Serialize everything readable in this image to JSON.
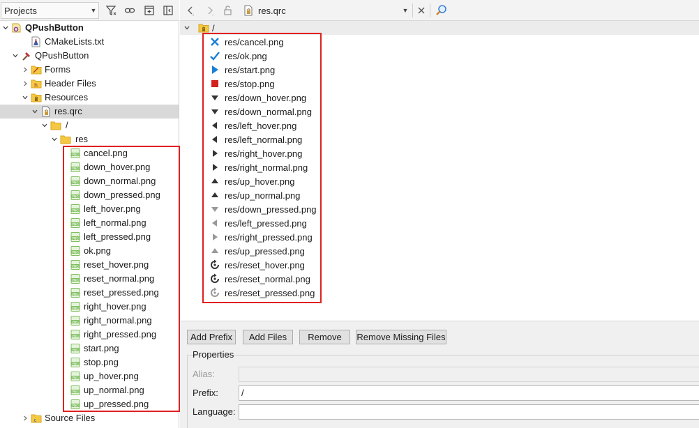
{
  "left_toolbar": {
    "combo_value": "Projects"
  },
  "tree": {
    "project": "QPushButton",
    "cmake": "CMakeLists.txt",
    "target": "QPushButton",
    "forms": "Forms",
    "headers": "Header Files",
    "resources": "Resources",
    "qrc": "res.qrc",
    "prefix": "/",
    "res_folder": "res",
    "files": [
      "cancel.png",
      "down_hover.png",
      "down_normal.png",
      "down_pressed.png",
      "left_hover.png",
      "left_normal.png",
      "left_pressed.png",
      "ok.png",
      "reset_hover.png",
      "reset_normal.png",
      "reset_pressed.png",
      "right_hover.png",
      "right_normal.png",
      "right_pressed.png",
      "start.png",
      "stop.png",
      "up_hover.png",
      "up_normal.png",
      "up_pressed.png"
    ],
    "sources": "Source Files"
  },
  "editor_toolbar": {
    "file_combo": "res.qrc"
  },
  "resource_editor": {
    "prefix": "/",
    "entries": [
      {
        "label": "res/cancel.png",
        "icon": "cancel-x-icon"
      },
      {
        "label": "res/ok.png",
        "icon": "ok-check-icon"
      },
      {
        "label": "res/start.png",
        "icon": "play-triangle-icon"
      },
      {
        "label": "res/stop.png",
        "icon": "stop-square-icon"
      },
      {
        "label": "res/down_hover.png",
        "icon": "down-arrow-icon"
      },
      {
        "label": "res/down_normal.png",
        "icon": "down-arrow-icon"
      },
      {
        "label": "res/left_hover.png",
        "icon": "left-arrow-icon"
      },
      {
        "label": "res/left_normal.png",
        "icon": "left-arrow-icon"
      },
      {
        "label": "res/right_hover.png",
        "icon": "right-arrow-icon"
      },
      {
        "label": "res/right_normal.png",
        "icon": "right-arrow-icon"
      },
      {
        "label": "res/up_hover.png",
        "icon": "up-arrow-icon"
      },
      {
        "label": "res/up_normal.png",
        "icon": "up-arrow-icon"
      },
      {
        "label": "res/down_pressed.png",
        "icon": "down-arrow-gray-icon"
      },
      {
        "label": "res/left_pressed.png",
        "icon": "left-arrow-gray-icon"
      },
      {
        "label": "res/right_pressed.png",
        "icon": "right-arrow-gray-icon"
      },
      {
        "label": "res/up_pressed.png",
        "icon": "up-arrow-gray-icon"
      },
      {
        "label": "res/reset_hover.png",
        "icon": "reset-icon"
      },
      {
        "label": "res/reset_normal.png",
        "icon": "reset-icon"
      },
      {
        "label": "res/reset_pressed.png",
        "icon": "reset-gray-icon"
      }
    ],
    "buttons": {
      "add_prefix": "Add Prefix",
      "add_files": "Add Files",
      "remove": "Remove",
      "remove_missing": "Remove Missing Files"
    },
    "properties": {
      "title": "Properties",
      "alias_label": "Alias:",
      "alias_value": "",
      "prefix_label": "Prefix:",
      "prefix_value": "/",
      "language_label": "Language:",
      "language_value": ""
    }
  },
  "colors": {
    "highlight_box": "#e02020",
    "selected_row": "#d9d9d9",
    "png_icon": "#7fbf5f",
    "folder": "#f5c842"
  }
}
